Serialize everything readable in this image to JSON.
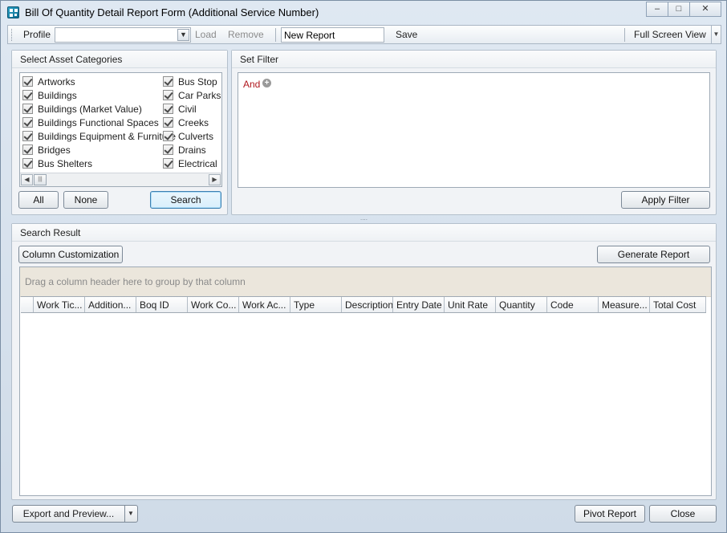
{
  "window": {
    "title": "Bill Of Quantity Detail Report Form (Additional Service Number)",
    "minimize_glyph": "–",
    "maximize_glyph": "□",
    "close_glyph": "✕"
  },
  "toolbar": {
    "profile_label": "Profile",
    "profile_value": "",
    "load_label": "Load",
    "remove_label": "Remove",
    "report_name_value": "New Report",
    "save_label": "Save",
    "full_screen_label": "Full Screen View"
  },
  "asset_categories": {
    "header": "Select Asset Categories",
    "column_a": [
      {
        "label": "Artworks",
        "checked": true
      },
      {
        "label": "Buildings",
        "checked": true
      },
      {
        "label": "Buildings (Market Value)",
        "checked": true
      },
      {
        "label": "Buildings Functional Spaces",
        "checked": true
      },
      {
        "label": "Buildings Equipment & Furniture",
        "checked": true
      },
      {
        "label": "Bridges",
        "checked": true
      },
      {
        "label": "Bus Shelters",
        "checked": true
      }
    ],
    "column_b": [
      {
        "label": "Bus Stop",
        "checked": true
      },
      {
        "label": "Car Parks",
        "checked": true
      },
      {
        "label": "Civil",
        "checked": true
      },
      {
        "label": "Creeks",
        "checked": true
      },
      {
        "label": "Culverts",
        "checked": true
      },
      {
        "label": "Drains",
        "checked": true
      },
      {
        "label": "Electrical",
        "checked": true
      }
    ],
    "all_label": "All",
    "none_label": "None",
    "search_label": "Search"
  },
  "filter": {
    "header": "Set Filter",
    "operator": "And",
    "apply_label": "Apply Filter"
  },
  "search_result": {
    "header": "Search Result",
    "column_customization_label": "Column Customization",
    "generate_report_label": "Generate Report",
    "group_hint": "Drag a column header here to group by that column",
    "columns": [
      "Work Tic...",
      "Addition...",
      "Boq ID",
      "Work Co...",
      "Work Ac...",
      "Type",
      "Description",
      "Entry Date",
      "Unit Rate",
      "Quantity",
      "Code",
      "Measure...",
      "Total Cost"
    ]
  },
  "bottom": {
    "export_label": "Export and Preview...",
    "pivot_label": "Pivot Report",
    "close_label": "Close"
  }
}
